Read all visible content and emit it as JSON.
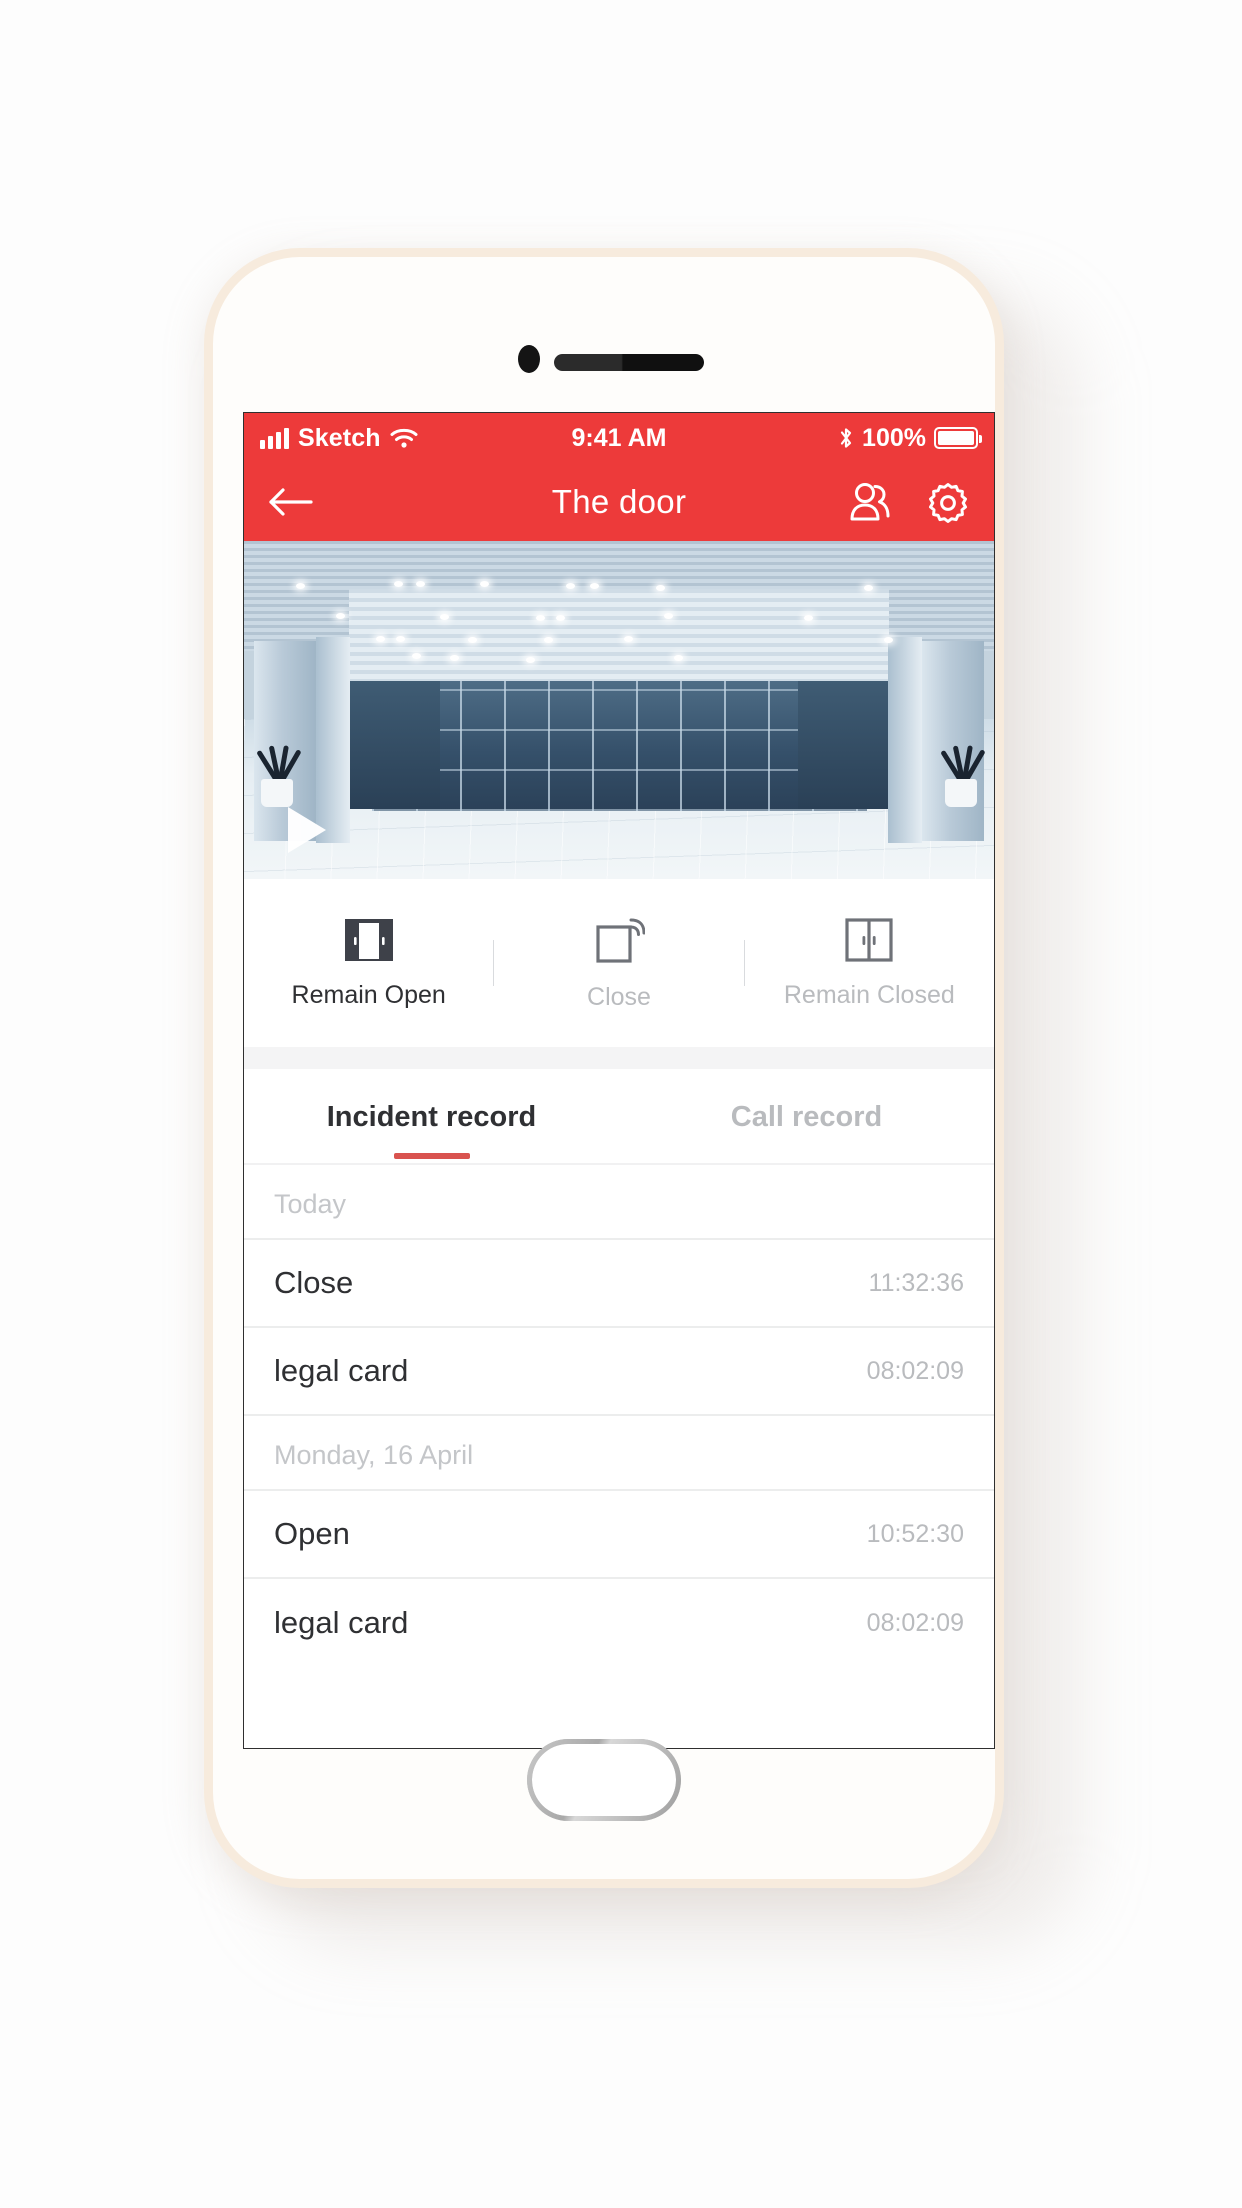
{
  "status_bar": {
    "carrier": "Sketch",
    "time": "9:41 AM",
    "battery_percent": "100%",
    "signal_icon": "signal-bars-icon",
    "wifi_icon": "wifi-icon",
    "bluetooth_icon": "bluetooth-icon",
    "battery_icon": "battery-full-icon"
  },
  "nav_bar": {
    "title": "The door",
    "back_icon": "arrow-left-icon",
    "users_icon": "users-icon",
    "settings_icon": "gear-icon",
    "background_color": "#ed3a3a"
  },
  "video": {
    "play_icon": "play-icon",
    "alt": "door-camera-preview"
  },
  "actions": [
    {
      "label": "Remain Open",
      "icon": "door-open-filled-icon",
      "active": true
    },
    {
      "label": "Close",
      "icon": "door-close-signal-icon",
      "active": false
    },
    {
      "label": "Remain Closed",
      "icon": "double-door-closed-icon",
      "active": false
    }
  ],
  "tabs": [
    {
      "label": "Incident record",
      "active": true
    },
    {
      "label": "Call record",
      "active": false
    }
  ],
  "records": [
    {
      "header": "Today",
      "rows": [
        {
          "title": "Close",
          "time": "11:32:36"
        },
        {
          "title": "legal card",
          "time": "08:02:09"
        }
      ]
    },
    {
      "header": "Monday, 16 April",
      "rows": [
        {
          "title": "Open",
          "time": "10:52:30"
        },
        {
          "title": "legal card",
          "time": "08:02:09"
        }
      ]
    }
  ],
  "colors": {
    "accent_red": "#ed3a3a",
    "tab_indicator": "#d9534f",
    "text_primary": "#2f3033",
    "text_muted": "#b9bbbe"
  }
}
